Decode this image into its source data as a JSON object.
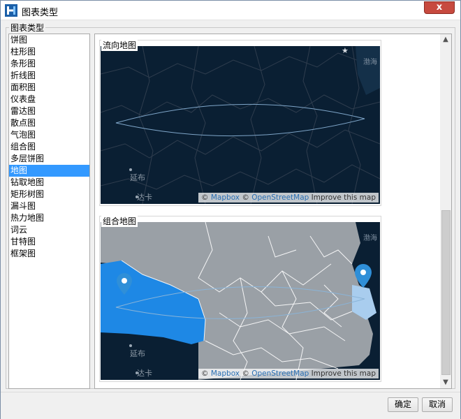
{
  "window": {
    "title": "图表类型",
    "close_label": "x"
  },
  "group": {
    "title": "图表类型"
  },
  "chart_types": [
    {
      "label": "饼图",
      "selected": false
    },
    {
      "label": "柱形图",
      "selected": false
    },
    {
      "label": "条形图",
      "selected": false
    },
    {
      "label": "折线图",
      "selected": false
    },
    {
      "label": "面积图",
      "selected": false
    },
    {
      "label": "仪表盘",
      "selected": false
    },
    {
      "label": "雷达图",
      "selected": false
    },
    {
      "label": "散点图",
      "selected": false
    },
    {
      "label": "气泡图",
      "selected": false
    },
    {
      "label": "组合图",
      "selected": false
    },
    {
      "label": "多层饼图",
      "selected": false
    },
    {
      "label": "地图",
      "selected": true
    },
    {
      "label": "钻取地图",
      "selected": false
    },
    {
      "label": "矩形树图",
      "selected": false
    },
    {
      "label": "漏斗图",
      "selected": false
    },
    {
      "label": "热力地图",
      "selected": false
    },
    {
      "label": "词云",
      "selected": false
    },
    {
      "label": "甘特图",
      "selected": false
    },
    {
      "label": "框架图",
      "selected": false
    }
  ],
  "previews": [
    {
      "title": "流向地图",
      "labels": {
        "bohai": "渤海",
        "yanbu": "延布",
        "daka": "达卡"
      },
      "attribution": {
        "sep1": "© ",
        "mapbox": "Mapbox",
        "sep2": " © ",
        "osm": "OpenStreetMap",
        "improve": " Improve this map"
      }
    },
    {
      "title": "组合地图",
      "labels": {
        "bohai": "渤海",
        "yanbu": "延布",
        "daka": "达卡"
      },
      "attribution": {
        "sep1": "© ",
        "mapbox": "Mapbox",
        "sep2": " © ",
        "osm": "OpenStreetMap",
        "improve": " Improve this map"
      }
    }
  ],
  "buttons": {
    "ok": "确定",
    "cancel": "取消"
  },
  "colors": {
    "selection": "#3399ff",
    "map_dark": "#0a1f33",
    "map_region_blue": "#1e88e5",
    "map_region_gray": "#9aa0a6",
    "marker_blue": "#2f8fd8"
  },
  "icons": {
    "app": "app-logo-icon",
    "scroll_up": "chevron-up-icon",
    "scroll_down": "chevron-down-icon"
  }
}
